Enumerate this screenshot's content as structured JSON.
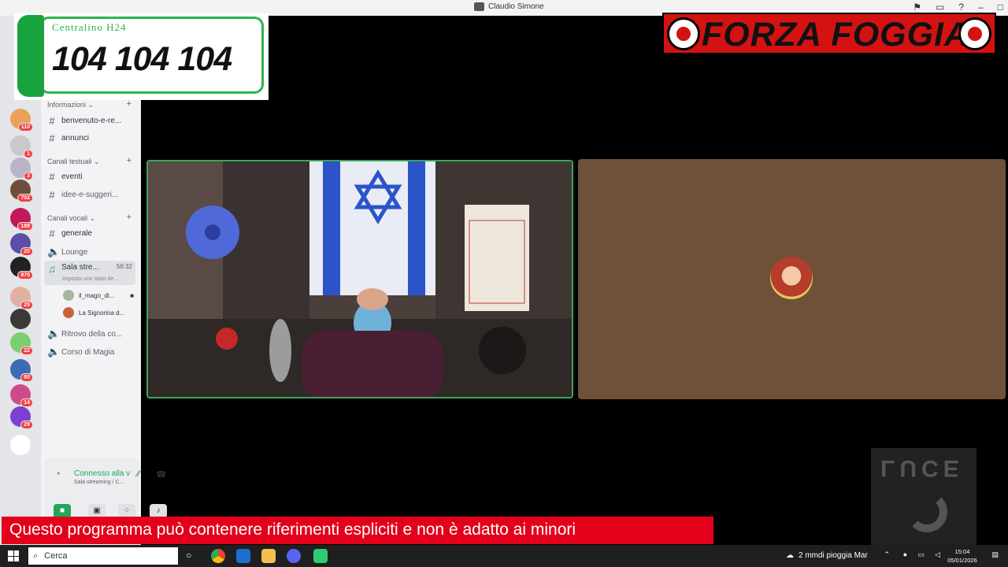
{
  "window": {
    "title": "Claudio Simone"
  },
  "overlay": {
    "phone_label": "Centralino H24",
    "phone_number": "104 104 104",
    "banner_text": "FORZA FOGGIA",
    "warning": "Questo programma  può contenere riferimenti espliciti e non è adatto ai minori",
    "watermark": "LUCE"
  },
  "rail": {
    "servers": [
      {
        "badge": "110",
        "color": "#e8a25a"
      },
      {
        "badge": "1",
        "color": "#c9c9c9"
      },
      {
        "badge": "3",
        "color": "#b9b4c7"
      },
      {
        "badge": "702",
        "color": "#6d4e3a"
      },
      {
        "badge": "189",
        "color": "#c2185b"
      },
      {
        "badge": "20",
        "color": "#5b4ea6"
      },
      {
        "badge": "870",
        "color": "#222222"
      },
      {
        "badge": "25",
        "color": "#e2b0a0"
      },
      {
        "badge": "",
        "color": "#3a3a3a"
      },
      {
        "badge": "22",
        "color": "#7ccf6f"
      },
      {
        "badge": "80",
        "color": "#3d6bb3"
      },
      {
        "badge": "14",
        "color": "#d04a8a"
      },
      {
        "badge": "29",
        "color": "#7b3fd1"
      },
      {
        "badge": "",
        "color": "#ffffff"
      }
    ]
  },
  "sidebar": {
    "categories": [
      {
        "label": "Informazioni",
        "channels": [
          "benvenuto-e-re...",
          "annunci"
        ]
      },
      {
        "label": "Canali testuali",
        "channels": [
          "eventi",
          "idee-e-suggeri..."
        ]
      },
      {
        "label": "Canali vocali",
        "channels": [
          "generale",
          "Lounge"
        ]
      }
    ],
    "active_channel": {
      "name": "Sala stre...",
      "time": "56:32",
      "status": "Imposta uno stato de..."
    },
    "users": [
      "il_mago_di...",
      "La Signorina d..."
    ],
    "more_channels": [
      "Ritrovo della co...",
      "Corso di Magia"
    ],
    "voice": {
      "title": "Connesso alla v",
      "subtitle": "Sala streaming / C..."
    }
  },
  "taskbar": {
    "search_placeholder": "Cerca",
    "weather": "2 mmdi pioggia Mar",
    "time": "15:04",
    "date": "05/01/2026"
  }
}
